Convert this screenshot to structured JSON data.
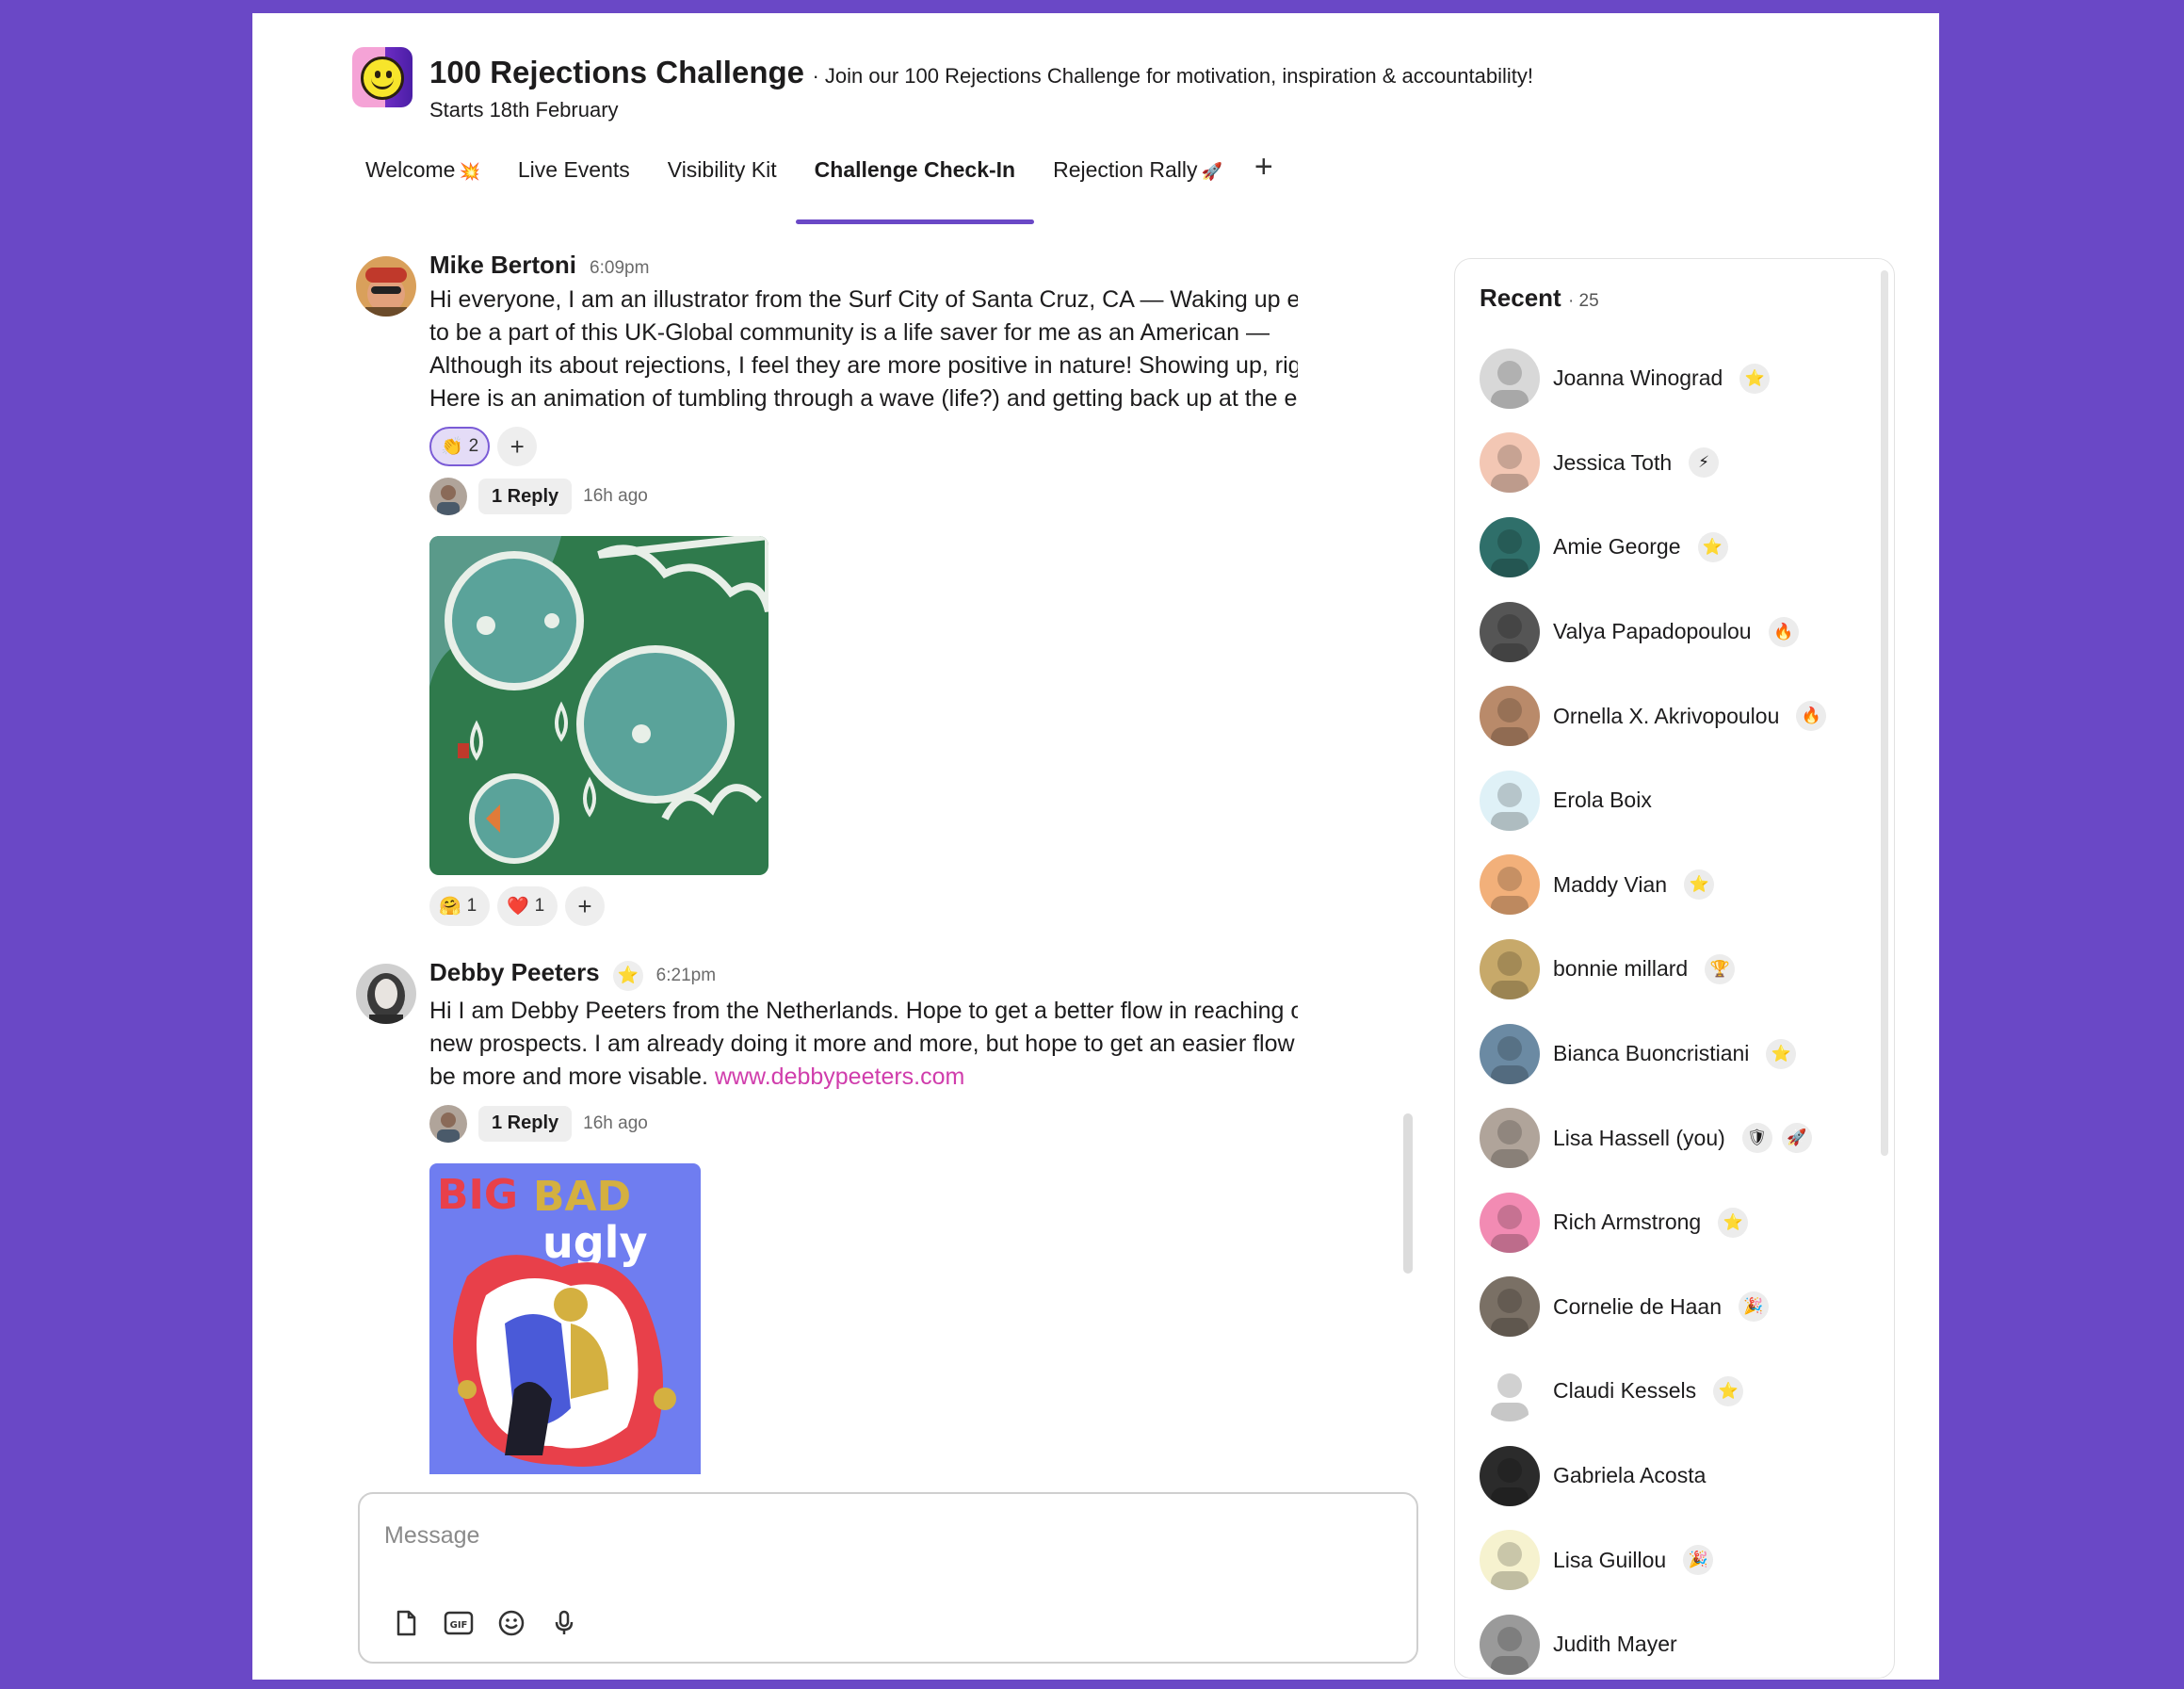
{
  "header": {
    "title": "100 Rejections Challenge",
    "tagline": "· Join our 100 Rejections Challenge for motivation, inspiration & accountability!",
    "subtitle": "Starts 18th February",
    "logo_icon": "smiley-face-icon"
  },
  "tabs": [
    {
      "label": "Welcome",
      "emoji": "💥"
    },
    {
      "label": "Live Events",
      "emoji": ""
    },
    {
      "label": "Visibility Kit",
      "emoji": ""
    },
    {
      "label": "Challenge Check-In",
      "emoji": "",
      "active": true
    },
    {
      "label": "Rejection Rally",
      "emoji": "🚀"
    }
  ],
  "add_tab_label": "+",
  "messages": [
    {
      "author": "Mike Bertoni",
      "time": "6:09pm",
      "body": "Hi everyone, I am an illustrator from the Surf City of Santa Cruz, CA — Waking up early to be a part of this UK-Global community is a life saver for me as an American — Although its about rejections, I feel they are more positive in nature! Showing up, right? Here is an animation of tumbling through a wave (life?) and getting back up at the end.",
      "reactions": [
        {
          "emoji": "👏",
          "count": "2"
        }
      ],
      "reply_label": "1  Reply",
      "reply_time": "16h ago",
      "attachment_reactions": [
        {
          "emoji": "🤗",
          "count": "1"
        },
        {
          "emoji": "❤️",
          "count": "1"
        }
      ]
    },
    {
      "author": "Debby Peeters",
      "time": "6:21pm",
      "badge": "⭐",
      "body": "Hi I am Debby Peeters from the Netherlands. Hope to get a better flow in reaching out to new prospects. I am already doing it more and more, but hope to get an easier flow and be more and more visable.",
      "link": "www.debbypeeters.com",
      "reply_label": "1  Reply",
      "reply_time": "16h ago"
    }
  ],
  "composer": {
    "placeholder": "Message",
    "tools": [
      "file-icon",
      "gif-icon",
      "emoji-icon",
      "microphone-icon"
    ]
  },
  "recent": {
    "title": "Recent",
    "count": "25",
    "people": [
      {
        "name": "Joanna Winograd",
        "badges": [
          "⭐"
        ],
        "avatar_color": "#d8d8d8"
      },
      {
        "name": "Jessica Toth",
        "badges": [
          "⚡"
        ],
        "avatar_color": "#f3c7b4"
      },
      {
        "name": "Amie George",
        "badges": [
          "⭐"
        ],
        "avatar_color": "#2f6f6a"
      },
      {
        "name": "Valya Papadopoulou",
        "badges": [
          "🔥"
        ],
        "avatar_color": "#555555"
      },
      {
        "name": "Ornella X. Akrivopoulou",
        "badges": [
          "🔥"
        ],
        "avatar_color": "#b98a6a"
      },
      {
        "name": "Erola Boix",
        "badges": [],
        "avatar_color": "#dff1f7"
      },
      {
        "name": "Maddy Vian",
        "badges": [
          "⭐"
        ],
        "avatar_color": "#f2b07a"
      },
      {
        "name": "bonnie millard",
        "badges": [
          "🏆"
        ],
        "avatar_color": "#c7a96a"
      },
      {
        "name": "Bianca Buoncristiani",
        "badges": [
          "⭐"
        ],
        "avatar_color": "#6b8aa3"
      },
      {
        "name": "Lisa Hassell (you)",
        "badges": [
          "🛡",
          "🚀"
        ],
        "avatar_color": "#b0a49a"
      },
      {
        "name": "Rich Armstrong",
        "badges": [
          "⭐"
        ],
        "avatar_color": "#f28bb3"
      },
      {
        "name": "Cornelie de Haan",
        "badges": [
          "🎉"
        ],
        "avatar_color": "#7a7065"
      },
      {
        "name": "Claudi Kessels",
        "badges": [
          "⭐"
        ],
        "avatar_color": "#ffffff"
      },
      {
        "name": "Gabriela Acosta",
        "badges": [],
        "avatar_color": "#2b2b2b"
      },
      {
        "name": "Lisa Guillou",
        "badges": [
          "🎉"
        ],
        "avatar_color": "#f6f2cf"
      },
      {
        "name": "Judith Mayer",
        "badges": [],
        "avatar_color": "#9a9a9a"
      }
    ]
  },
  "colors": {
    "accent": "#6a48c6",
    "link": "#d03dac",
    "background": "#6a48c6"
  }
}
